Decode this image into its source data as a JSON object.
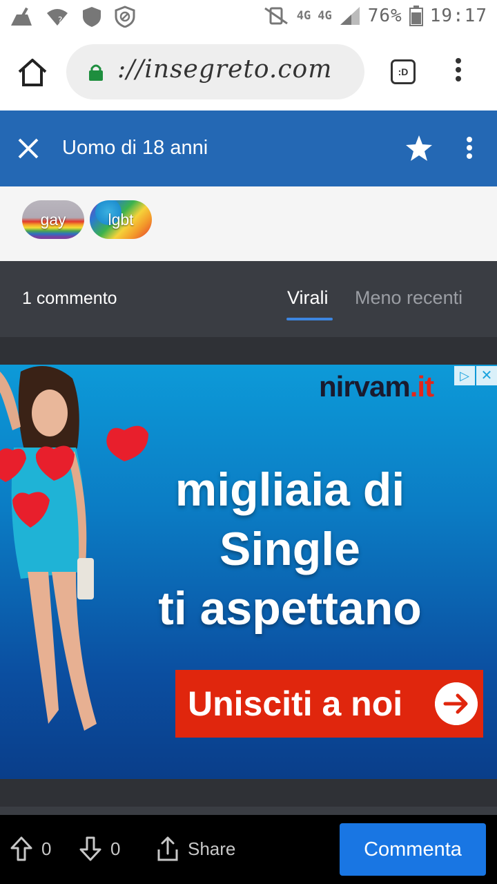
{
  "status_bar": {
    "network_1": "4G",
    "network_2": "4G",
    "battery": "76%",
    "time": "19:17"
  },
  "browser": {
    "url": "://insegreto.com",
    "tab_label": ":D"
  },
  "header": {
    "title": "Uomo di 18 anni"
  },
  "tags": [
    {
      "label": "gay"
    },
    {
      "label": "lgbt"
    }
  ],
  "comments_bar": {
    "count": "1 commento",
    "sort_options": [
      "Virali",
      "Meno recenti"
    ],
    "active_sort": "Virali"
  },
  "ad": {
    "brand_name": "nirvam",
    "brand_dot": ".it",
    "headline_line1": "migliaia di",
    "headline_line2": "Single",
    "headline_line3": "ti aspettano",
    "cta": "Unisciti a noi",
    "close_glyph": "✕"
  },
  "bottom_bar": {
    "upvotes": "0",
    "downvotes": "0",
    "share_label": "Share",
    "comment_label": "Commenta"
  },
  "colors": {
    "header_blue": "#2468b4",
    "comment_button": "#1976e3",
    "cta_red": "#e0260d"
  }
}
